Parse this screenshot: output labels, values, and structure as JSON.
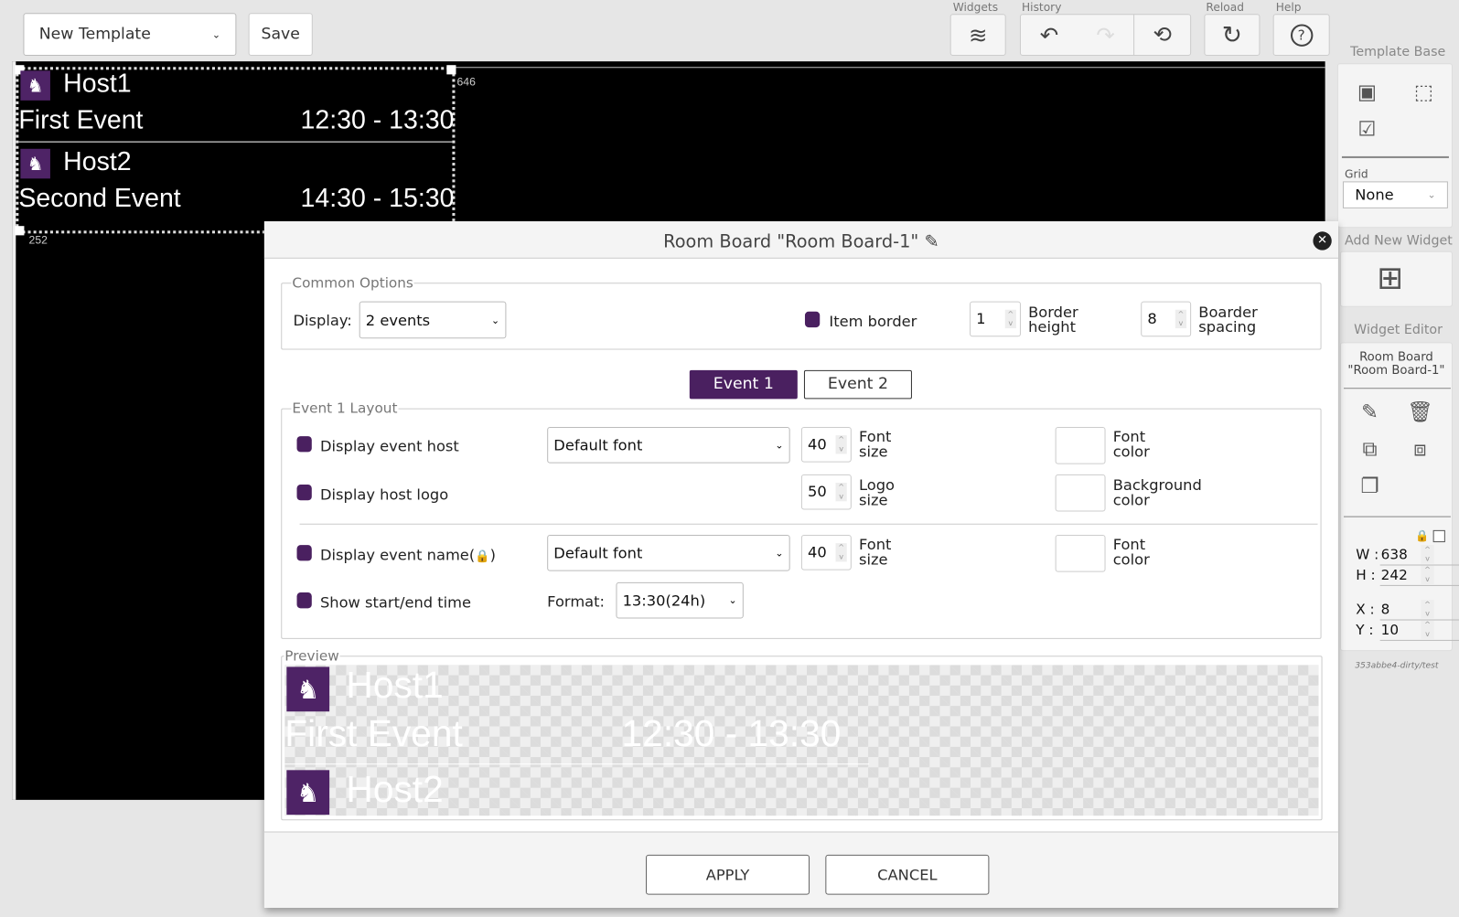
{
  "toolbar": {
    "template_select": "New Template",
    "save": "Save",
    "widgets_label": "Widgets",
    "history_label": "History",
    "reload_label": "Reload",
    "help_label": "Help"
  },
  "canvas": {
    "coord_x": "8",
    "coord_y": "10",
    "right_edge": "646",
    "bottom_edge": "252",
    "events": [
      {
        "host": "Host1",
        "name": "First Event",
        "time": "12:30 - 13:30"
      },
      {
        "host": "Host2",
        "name": "Second Event",
        "time": "14:30 - 15:30"
      }
    ]
  },
  "right_panel": {
    "template_base_label": "Template Base",
    "grid_label": "Grid",
    "grid_value": "None",
    "add_widget_label": "Add New Widget",
    "widget_editor_label": "Widget Editor",
    "widget_name_line1": "Room Board",
    "widget_name_line2": "\"Room Board-1\"",
    "w_label": "W :",
    "w": "638",
    "h_label": "H :",
    "h": "242",
    "x_label": "X :",
    "x": "8",
    "y_label": "Y :",
    "y": "10",
    "version": "353abbe4-dirty/test"
  },
  "dialog": {
    "title": "Room Board \"Room Board-1\"",
    "common": {
      "legend": "Common Options",
      "display_label": "Display:",
      "display_value": "2 events",
      "item_border": "Item border",
      "border_height": "1",
      "border_height_l1": "Border",
      "border_height_l2": "height",
      "spacing": "8",
      "spacing_l1": "Boarder",
      "spacing_l2": "spacing"
    },
    "tabs": [
      "Event 1",
      "Event 2"
    ],
    "layout": {
      "legend": "Event 1 Layout",
      "host": "Display event host",
      "host_font": "Default font",
      "host_size": "40",
      "font_l1": "Font",
      "size_l2": "size",
      "color_l2": "color",
      "logo": "Display host logo",
      "logo_size": "50",
      "logo_l1": "Logo",
      "bg_l1": "Background",
      "name": "Display event name(",
      "name_end": ")",
      "name_font": "Default font",
      "name_size": "40",
      "time": "Show start/end time",
      "format_label": "Format:",
      "format_value": "13:30(24h)"
    },
    "preview": {
      "legend": "Preview",
      "host1": "Host1",
      "event1": "First Event",
      "time1": "12:30 - 13:30",
      "host2": "Host2"
    },
    "apply": "APPLY",
    "cancel": "CANCEL"
  },
  "colors": {
    "accent": "#4a2060",
    "canvas": "#000000",
    "logo_bg": "#4e2366"
  }
}
